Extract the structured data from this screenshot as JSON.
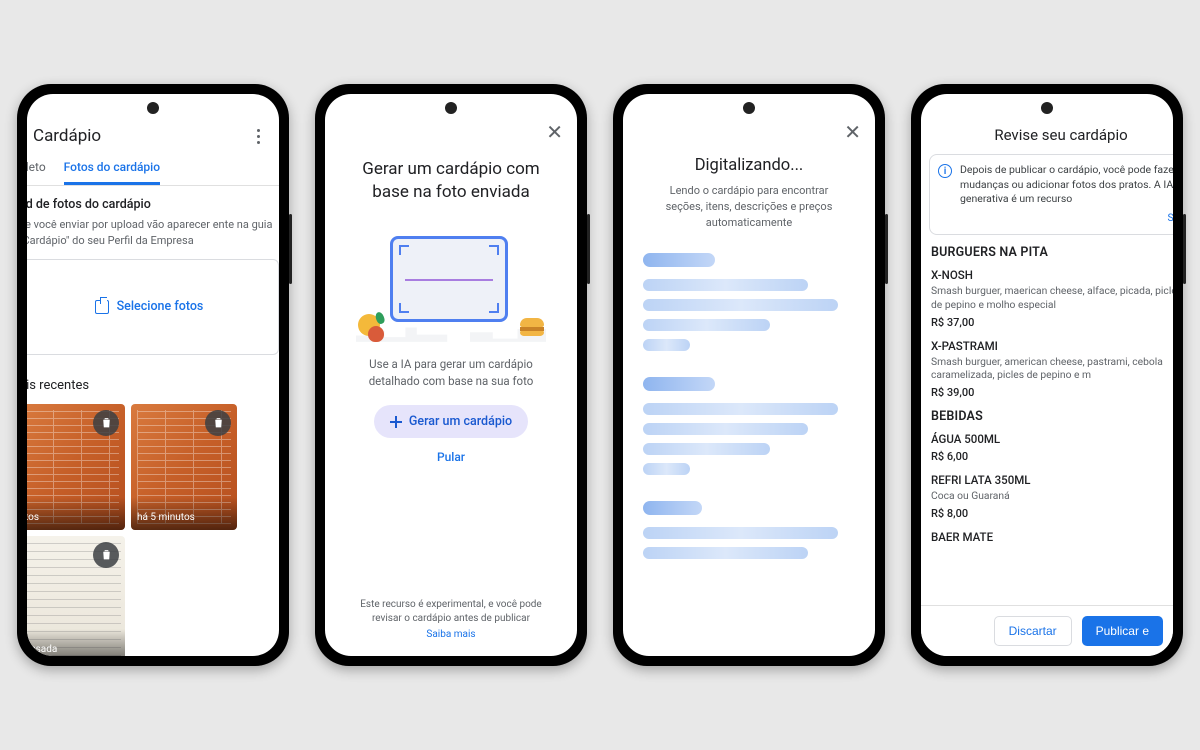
{
  "screen1": {
    "title": "Cardápio",
    "tabs": {
      "completo": "pleto",
      "fotos": "Fotos do cardápio"
    },
    "upload_heading": "ad de fotos do cardápio",
    "upload_sub": "ue você enviar por upload vão aparecer ente na guia \"Cardápio\" do seu Perfil da Empresa",
    "select_photos": "Selecione fotos",
    "recent_heading": "ais recentes",
    "thumbs": [
      {
        "caption": "tos"
      },
      {
        "caption": "há 5 minutos"
      },
      {
        "caption": "assada"
      }
    ]
  },
  "screen2": {
    "title": "Gerar um cardápio com base na foto enviada",
    "subtitle": "Use a IA para gerar um cardápio detalhado com base na sua foto",
    "button": "Gerar um cardápio",
    "skip": "Pular",
    "disclaimer": "Este recurso é experimental, e você pode revisar o cardápio antes de publicar",
    "learn_more": "Saiba mais"
  },
  "screen3": {
    "title": "Digitalizando...",
    "subtitle": "Lendo o cardápio para encontrar seções, itens, descrições e preços automaticamente"
  },
  "screen4": {
    "title": "Revise seu cardápio",
    "info": "Depois de publicar o cardápio, você pode fazer mudanças ou adicionar fotos dos pratos. A IA generativa é um recurso",
    "info_more": "Sai",
    "sections": [
      {
        "name": "BURGUERS NA PITA",
        "items": [
          {
            "name": "X-NOSH",
            "desc": "Smash burguer, maerican cheese, alface, picada, picles de pepino e molho especial",
            "price": "R$ 37,00"
          },
          {
            "name": "X-PASTRAMI",
            "desc": "Smash burguer, american cheese, pastrami, cebola caramelizada, picles de pepino e m",
            "price": "R$ 39,00"
          }
        ]
      },
      {
        "name": "BEBIDAS",
        "items": [
          {
            "name": "ÁGUA 500ML",
            "desc": "",
            "price": "R$ 6,00"
          },
          {
            "name": "REFRI LATA 350ML",
            "desc": "Coca ou Guaraná",
            "price": "R$ 8,00"
          },
          {
            "name": "BAER MATE",
            "desc": "",
            "price": ""
          }
        ]
      }
    ],
    "discard": "Discartar",
    "publish": "Publicar e"
  }
}
